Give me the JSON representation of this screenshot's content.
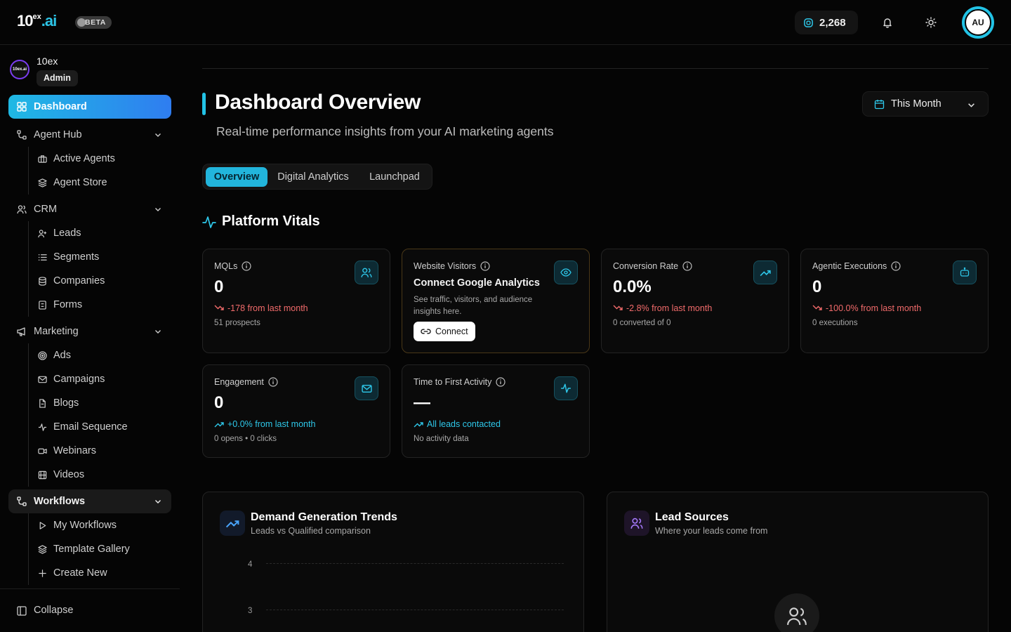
{
  "brand": {
    "logo_main": "10",
    "logo_sup": "ex",
    "logo_suffix": ".ai",
    "beta": "BETA"
  },
  "topbar": {
    "credits": "2,268",
    "avatar_initials": "AU"
  },
  "org": {
    "name": "10ex",
    "role": "Admin",
    "logo_text": "10ex.ai"
  },
  "sidebar": {
    "dashboard": "Dashboard",
    "agent_hub": {
      "label": "Agent Hub",
      "items": [
        "Active Agents",
        "Agent Store"
      ]
    },
    "crm": {
      "label": "CRM",
      "items": [
        "Leads",
        "Segments",
        "Companies",
        "Forms"
      ]
    },
    "marketing": {
      "label": "Marketing",
      "items": [
        "Ads",
        "Campaigns",
        "Blogs",
        "Email Sequence",
        "Webinars",
        "Videos"
      ]
    },
    "workflows": {
      "label": "Workflows",
      "items": [
        "My Workflows",
        "Template Gallery",
        "Create New"
      ]
    },
    "collapse": "Collapse"
  },
  "header": {
    "title": "Dashboard Overview",
    "subtitle": "Real-time performance insights from your AI marketing agents",
    "period": "This Month"
  },
  "tabs": [
    "Overview",
    "Digital Analytics",
    "Launchpad"
  ],
  "vitals": {
    "title": "Platform Vitals",
    "mqls": {
      "title": "MQLs",
      "value": "0",
      "delta": "-178 from last month",
      "note": "51 prospects"
    },
    "visitors": {
      "title": "Website Visitors",
      "cta_title": "Connect Google Analytics",
      "desc": "See traffic, visitors, and audience insights here.",
      "button": "Connect"
    },
    "conversion": {
      "title": "Conversion Rate",
      "value": "0.0%",
      "delta": "-2.8% from last month",
      "note": "0 converted of 0"
    },
    "agentic": {
      "title": "Agentic Executions",
      "value": "0",
      "delta": "-100.0% from last month",
      "note": "0 executions"
    },
    "engagement": {
      "title": "Engagement",
      "value": "0",
      "delta": "+0.0% from last month",
      "note": "0 opens • 0 clicks"
    },
    "ttfa": {
      "title": "Time to First Activity",
      "value": "—",
      "delta": "All leads contacted",
      "note": "No activity data"
    }
  },
  "panels": {
    "demand": {
      "title": "Demand Generation Trends",
      "subtitle": "Leads vs Qualified comparison",
      "y_ticks": [
        "4",
        "3"
      ]
    },
    "sources": {
      "title": "Lead Sources",
      "subtitle": "Where your leads come from"
    }
  },
  "colors": {
    "accent": "#22c3e6",
    "negative": "#f26b6b",
    "positive": "#2ec8ea",
    "purple": "#a87bff"
  }
}
